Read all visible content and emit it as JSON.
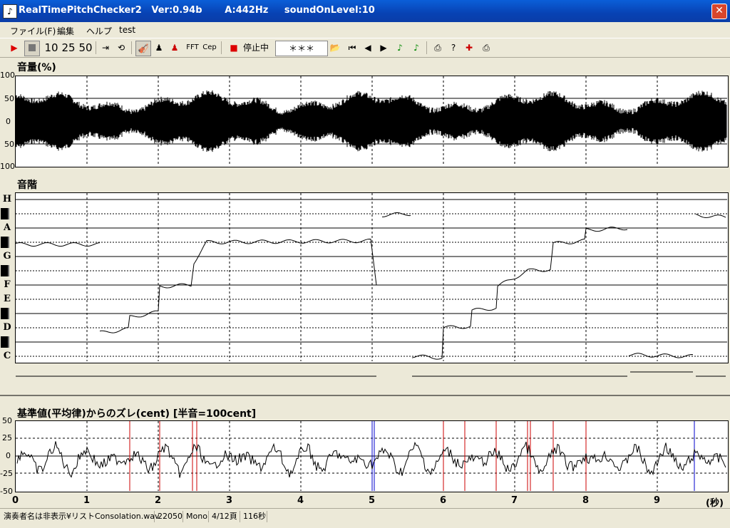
{
  "window": {
    "title": "RealTimePitchChecker2   Ver:0.94b       A:442Hz     soundOnLevel:10",
    "close": "✕"
  },
  "menu": [
    "ファイル(F)",
    "編集",
    "ヘルプ",
    "test"
  ],
  "toolbar": {
    "zoom": [
      "10",
      "25",
      "50"
    ],
    "fft": "FFT",
    "cep": "Cep",
    "status": "停止中",
    "display": "＊＊＊"
  },
  "volume_panel": {
    "title": "音量(%)",
    "ticks": [
      "100",
      "50",
      "0",
      "50",
      "100"
    ]
  },
  "scale_panel": {
    "title": "音階",
    "notes": [
      "H",
      "A",
      "G",
      "F",
      "E",
      "D",
      "C"
    ]
  },
  "cent_panel": {
    "title": "基準値(平均律)からのズレ(cent) [半音=100cent]",
    "ticks": [
      "50",
      "25",
      "0",
      "-25",
      "-50"
    ]
  },
  "time_axis": {
    "ticks": [
      "0",
      "1",
      "2",
      "3",
      "4",
      "5",
      "6",
      "7",
      "8",
      "9"
    ],
    "unit": "(秒)"
  },
  "statusbar": {
    "file": "演奏者名は非表示¥リストConsolation.wav",
    "rate": "22050",
    "channels": "Mono",
    "page": "4/12頁",
    "duration": "116秒"
  },
  "colors": {
    "title_bar": "#0842b4",
    "red_marker": "#cc0000",
    "blue_marker": "#0000cc"
  }
}
